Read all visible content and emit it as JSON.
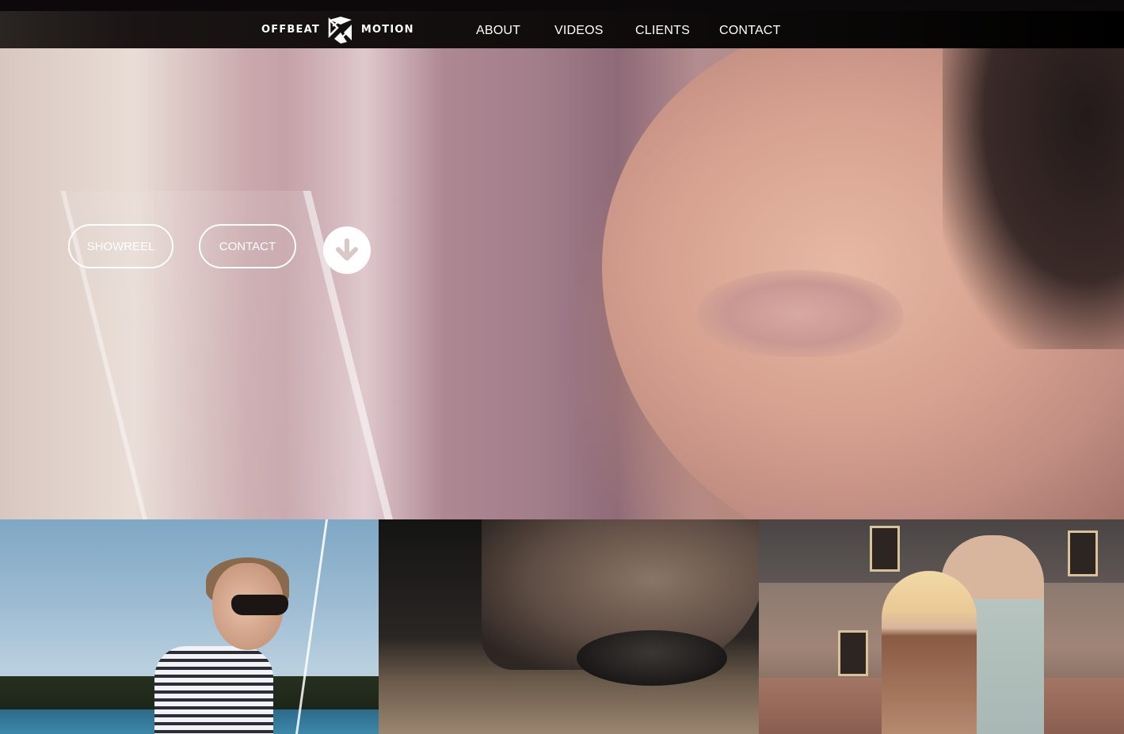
{
  "brand": {
    "name_left": "OFFBEAT",
    "name_right": "MOTION"
  },
  "nav": {
    "items": [
      {
        "label": "ABOUT"
      },
      {
        "label": "VIDEOS"
      },
      {
        "label": "CLIENTS"
      },
      {
        "label": "CONTACT"
      }
    ]
  },
  "hero": {
    "showreel_label": "SHOWREEL",
    "contact_label": "CONTACT",
    "scroll_icon": "arrow-down-circle-icon"
  },
  "thumbnails": [
    {
      "description_icon": "video-thumbnail"
    },
    {
      "description_icon": "video-thumbnail"
    },
    {
      "description_icon": "video-thumbnail"
    }
  ],
  "colors": {
    "nav_background": "#0b0908",
    "nav_text": "#ffffff",
    "button_border": "#ffffff"
  }
}
